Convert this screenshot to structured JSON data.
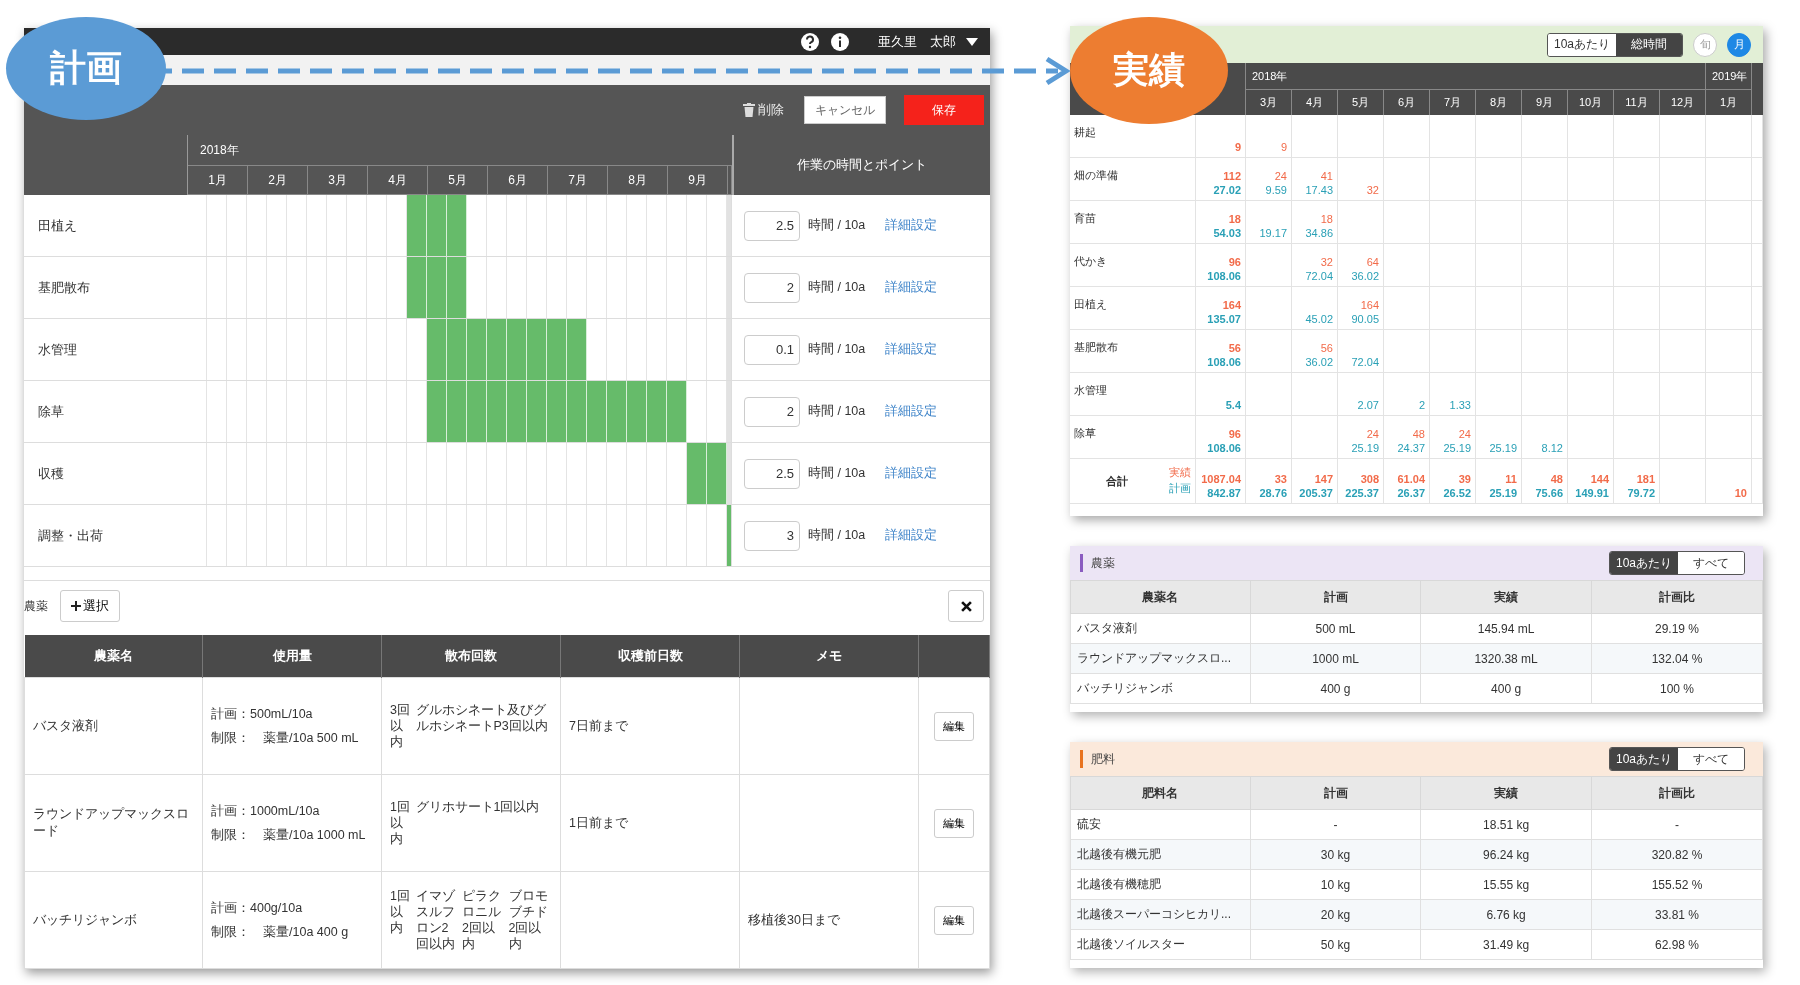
{
  "callouts": [
    {
      "kind": "plan",
      "label": "計画",
      "color": "#5b9bd5"
    },
    {
      "kind": "actual",
      "label": "実績",
      "color": "#ed7d31"
    }
  ],
  "plan_screen": {
    "user": "亜久里　太郎",
    "toolbar": {
      "delete": "削除",
      "cancel": "キャンセル",
      "save": "保存"
    },
    "gantt": {
      "year": "2018年",
      "months": [
        "1月",
        "2月",
        "3月",
        "4月",
        "5月",
        "6月",
        "7月",
        "8月",
        "9月"
      ],
      "points_header": "作業の時間とポイント",
      "rows": [
        {
          "task": "田植え",
          "periods": [
            false,
            false,
            false,
            false,
            false,
            false,
            false,
            false,
            false,
            false,
            false,
            true,
            true,
            true,
            false,
            false,
            false,
            false,
            false,
            false,
            false,
            false,
            false,
            false,
            false,
            false,
            false,
            false
          ],
          "hours": "2.5",
          "unit": "時間 / 10a",
          "link": "詳細設定"
        },
        {
          "task": "基肥散布",
          "periods": [
            false,
            false,
            false,
            false,
            false,
            false,
            false,
            false,
            false,
            false,
            false,
            true,
            true,
            true,
            false,
            false,
            false,
            false,
            false,
            false,
            false,
            false,
            false,
            false,
            false,
            false,
            false,
            false
          ],
          "hours": "2",
          "unit": "時間 / 10a",
          "link": "詳細設定"
        },
        {
          "task": "水管理",
          "periods": [
            false,
            false,
            false,
            false,
            false,
            false,
            false,
            false,
            false,
            false,
            false,
            false,
            true,
            true,
            true,
            true,
            true,
            true,
            true,
            true,
            false,
            false,
            false,
            false,
            false,
            false,
            false,
            false
          ],
          "hours": "0.1",
          "unit": "時間 / 10a",
          "link": "詳細設定"
        },
        {
          "task": "除草",
          "periods": [
            false,
            false,
            false,
            false,
            false,
            false,
            false,
            false,
            false,
            false,
            false,
            false,
            true,
            true,
            true,
            true,
            true,
            true,
            true,
            true,
            true,
            true,
            true,
            true,
            true,
            false,
            false,
            false
          ],
          "hours": "2",
          "unit": "時間 / 10a",
          "link": "詳細設定"
        },
        {
          "task": "収穫",
          "periods": [
            false,
            false,
            false,
            false,
            false,
            false,
            false,
            false,
            false,
            false,
            false,
            false,
            false,
            false,
            false,
            false,
            false,
            false,
            false,
            false,
            false,
            false,
            false,
            false,
            false,
            true,
            true,
            false
          ],
          "hours": "2.5",
          "unit": "時間 / 10a",
          "link": "詳細設定"
        },
        {
          "task": "調整・出荷",
          "periods": [
            false,
            false,
            false,
            false,
            false,
            false,
            false,
            false,
            false,
            false,
            false,
            false,
            false,
            false,
            false,
            false,
            false,
            false,
            false,
            false,
            false,
            false,
            false,
            false,
            false,
            false,
            false,
            true
          ],
          "hours": "3",
          "unit": "時間 / 10a",
          "link": "詳細設定"
        }
      ]
    },
    "pesticides": {
      "label": "農薬",
      "add": "選択",
      "columns": [
        "農薬名",
        "使用量",
        "散布回数",
        "収穫前日数",
        "メモ"
      ],
      "rows": [
        {
          "name": "バスタ液剤",
          "usage_plan": "計画：500mL/10a",
          "usage_limit": "制限：　薬量/10a 500 mL",
          "count": "3回以内",
          "ingredients": [
            "グルホシネート及びグルホシネートP3回以内"
          ],
          "preharvest": "7日前まで",
          "edit": "編集"
        },
        {
          "name": "ラウンドアップマックスロード",
          "usage_plan": "計画：1000mL/10a",
          "usage_limit": "制限：　薬量/10a 1000 mL",
          "count": "1回以内",
          "ingredients": [
            "グリホサート1回以内"
          ],
          "preharvest": "1日前まで",
          "edit": "編集"
        },
        {
          "name": "バッチリジャンボ",
          "usage_plan": "計画：400g/10a",
          "usage_limit": "制限：　薬量/10a 400 g",
          "count": "1回以内",
          "ingredients": [
            "イマゾスルフロン2回以内",
            "ピラクロニル2回以内",
            "ブロモブチド2回以内"
          ],
          "memo": "移植後30日まで",
          "edit": "編集"
        }
      ]
    }
  },
  "results": {
    "unit_toggle": [
      {
        "label": "10aあたり",
        "selected": false
      },
      {
        "label": "総時間",
        "selected": true
      }
    ],
    "period_toggle": [
      {
        "label": "旬",
        "selected": false
      },
      {
        "label": "月",
        "selected": true
      }
    ],
    "year_groups": [
      {
        "year": "2018年",
        "months": [
          "3月",
          "4月",
          "5月",
          "6月",
          "7月",
          "8月",
          "9月",
          "10月",
          "11月",
          "12月"
        ]
      },
      {
        "year": "2019年",
        "months": [
          "1月"
        ]
      }
    ],
    "rows": [
      {
        "task": "耕起",
        "total": {
          "actual": "9"
        },
        "cells": [
          {
            "actual": "9"
          },
          {},
          {},
          {},
          {},
          {},
          {},
          {},
          {},
          {},
          {}
        ]
      },
      {
        "task": "畑の準備",
        "total": {
          "actual": "112",
          "plan": "27.02"
        },
        "cells": [
          {
            "actual": "24",
            "plan": "9.59"
          },
          {
            "actual": "41",
            "plan": "17.43"
          },
          {
            "actual": "32"
          },
          {},
          {},
          {},
          {},
          {},
          {},
          {},
          {}
        ]
      },
      {
        "task": "育苗",
        "total": {
          "actual": "18",
          "plan": "54.03"
        },
        "cells": [
          {
            "plan": "19.17"
          },
          {
            "actual": "18",
            "plan": "34.86"
          },
          {},
          {},
          {},
          {},
          {},
          {},
          {},
          {},
          {}
        ]
      },
      {
        "task": "代かき",
        "total": {
          "actual": "96",
          "plan": "108.06"
        },
        "cells": [
          {},
          {
            "actual": "32",
            "plan": "72.04"
          },
          {
            "actual": "64",
            "plan": "36.02"
          },
          {},
          {},
          {},
          {},
          {},
          {},
          {},
          {}
        ]
      },
      {
        "task": "田植え",
        "total": {
          "actual": "164",
          "plan": "135.07"
        },
        "cells": [
          {},
          {
            "plan": "45.02"
          },
          {
            "actual": "164",
            "plan": "90.05"
          },
          {},
          {},
          {},
          {},
          {},
          {},
          {},
          {}
        ]
      },
      {
        "task": "基肥散布",
        "total": {
          "actual": "56",
          "plan": "108.06"
        },
        "cells": [
          {},
          {
            "actual": "56",
            "plan": "36.02"
          },
          {
            "plan": "72.04"
          },
          {},
          {},
          {},
          {},
          {},
          {},
          {},
          {}
        ]
      },
      {
        "task": "水管理",
        "total": {
          "plan": "5.4"
        },
        "cells": [
          {},
          {},
          {
            "plan": "2.07"
          },
          {
            "plan": "2"
          },
          {
            "plan": "1.33"
          },
          {},
          {},
          {},
          {},
          {},
          {}
        ]
      },
      {
        "task": "除草",
        "total": {
          "actual": "96",
          "plan": "108.06"
        },
        "cells": [
          {},
          {},
          {
            "actual": "24",
            "plan": "25.19"
          },
          {
            "actual": "48",
            "plan": "24.37"
          },
          {
            "actual": "24",
            "plan": "25.19"
          },
          {
            "plan": "25.19"
          },
          {
            "plan": "8.12"
          },
          {},
          {},
          {},
          {}
        ]
      }
    ],
    "total_row": {
      "label": "合計",
      "actual_label": "実績",
      "plan_label": "計画",
      "total": {
        "actual": "1087.04",
        "plan": "842.87"
      },
      "cells": [
        {
          "actual": "33",
          "plan": "28.76"
        },
        {
          "actual": "147",
          "plan": "205.37"
        },
        {
          "actual": "308",
          "plan": "225.37"
        },
        {
          "actual": "61.04",
          "plan": "26.37"
        },
        {
          "actual": "39",
          "plan": "26.52"
        },
        {
          "actual": "11",
          "plan": "25.19"
        },
        {
          "actual": "48",
          "plan": "75.66"
        },
        {
          "actual": "144",
          "plan": "149.91"
        },
        {
          "actual": "181",
          "plan": "79.72"
        },
        {},
        {
          "actual": "10"
        }
      ]
    }
  },
  "summaries": [
    {
      "title": "農薬",
      "color": "#8a5cc0",
      "toggle": [
        {
          "label": "10aあたり",
          "selected": true
        },
        {
          "label": "すべて",
          "selected": false
        }
      ],
      "columns": [
        "農薬名",
        "計画",
        "実績",
        "計画比"
      ],
      "rows": [
        [
          "バスタ液剤",
          "500 mL",
          "145.94 mL",
          "29.19 %"
        ],
        [
          "ラウンドアップマックスロ...",
          "1000 mL",
          "1320.38 mL",
          "132.04 %"
        ],
        [
          "バッチリジャンボ",
          "400 g",
          "400 g",
          "100 %"
        ]
      ]
    },
    {
      "title": "肥料",
      "color": "#e8731f",
      "toggle": [
        {
          "label": "10aあたり",
          "selected": true
        },
        {
          "label": "すべて",
          "selected": false
        }
      ],
      "columns": [
        "肥料名",
        "計画",
        "実績",
        "計画比"
      ],
      "rows": [
        [
          "硫安",
          "-",
          "18.51 kg",
          "-"
        ],
        [
          "北越後有機元肥",
          "30 kg",
          "96.24 kg",
          "320.82 %"
        ],
        [
          "北越後有機穂肥",
          "10 kg",
          "15.55 kg",
          "155.52 %"
        ],
        [
          "北越後スーパーコシヒカリ...",
          "20 kg",
          "6.76 kg",
          "33.81 %"
        ],
        [
          "北越後ソイルスター",
          "50 kg",
          "31.49 kg",
          "62.98 %"
        ]
      ]
    }
  ]
}
